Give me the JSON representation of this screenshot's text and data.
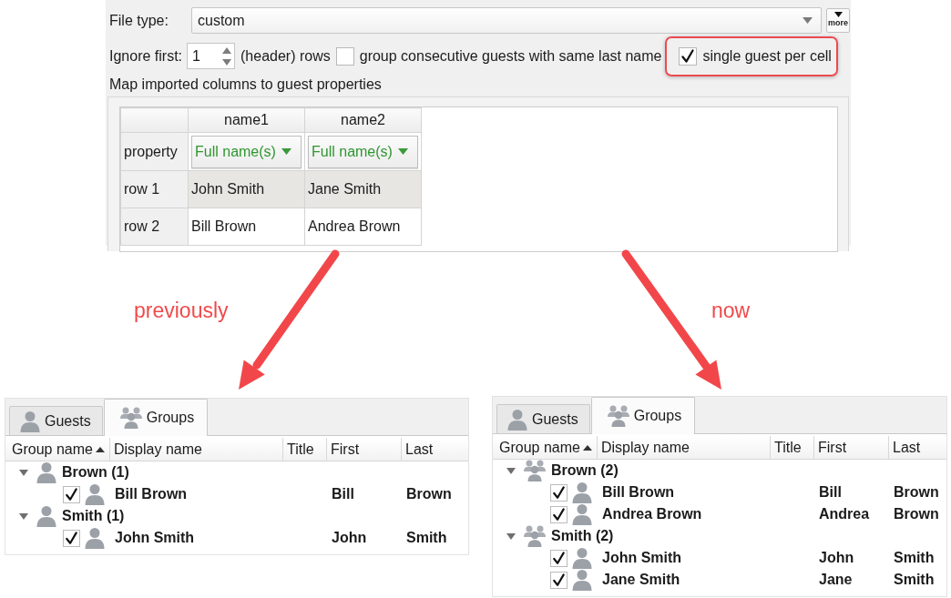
{
  "import_settings": {
    "file_type": {
      "label": "File type:",
      "value": "custom"
    },
    "more_button": {
      "label": "more"
    },
    "ignore_first": {
      "label": "Ignore first:",
      "value": "1",
      "suffix": "(header) rows"
    },
    "options": [
      {
        "label": "group consecutive guests with same last name",
        "checked": false,
        "highlighted": false
      },
      {
        "label": "single guest per cell",
        "checked": true,
        "highlighted": true
      }
    ],
    "mapping": {
      "title": "Map imported columns to guest properties",
      "columns": [
        "name1",
        "name2"
      ],
      "property_row": {
        "header": "property",
        "values": [
          "Full name(s)",
          "Full name(s)"
        ]
      },
      "rows": [
        {
          "header": "row 1",
          "cells": [
            "John Smith",
            "Jane Smith"
          ]
        },
        {
          "header": "row 2",
          "cells": [
            "Bill Brown",
            "Andrea Brown"
          ]
        }
      ]
    }
  },
  "comparisons": [
    {
      "caption": "previously",
      "panel": {
        "tabs": [
          {
            "label": "Guests",
            "kind": "person",
            "selected": false
          },
          {
            "label": "Groups",
            "kind": "people",
            "selected": true
          }
        ],
        "columns": [
          {
            "label": "Group name",
            "sorted": true
          },
          {
            "label": "Display name",
            "sorted": false
          },
          {
            "label": "Title",
            "sorted": false
          },
          {
            "label": "First",
            "sorted": false
          },
          {
            "label": "Last",
            "sorted": false
          }
        ],
        "groups": [
          {
            "name": "Brown (1)",
            "kind": "person",
            "expanded": true,
            "children": [
              {
                "display_name": "Bill Brown",
                "first": "Bill",
                "last": "Brown",
                "checked": true
              }
            ]
          },
          {
            "name": "Smith (1)",
            "kind": "person",
            "expanded": true,
            "children": [
              {
                "display_name": "John Smith",
                "first": "John",
                "last": "Smith",
                "checked": true
              }
            ]
          }
        ]
      }
    },
    {
      "caption": "now",
      "panel": {
        "tabs": [
          {
            "label": "Guests",
            "kind": "person",
            "selected": false
          },
          {
            "label": "Groups",
            "kind": "people",
            "selected": true
          }
        ],
        "columns": [
          {
            "label": "Group name",
            "sorted": true
          },
          {
            "label": "Display name",
            "sorted": false
          },
          {
            "label": "Title",
            "sorted": false
          },
          {
            "label": "First",
            "sorted": false
          },
          {
            "label": "Last",
            "sorted": false
          }
        ],
        "groups": [
          {
            "name": "Brown (2)",
            "kind": "people",
            "expanded": true,
            "children": [
              {
                "display_name": "Bill Brown",
                "first": "Bill",
                "last": "Brown",
                "checked": true
              },
              {
                "display_name": "Andrea Brown",
                "first": "Andrea",
                "last": "Brown",
                "checked": true
              }
            ]
          },
          {
            "name": "Smith (2)",
            "kind": "people",
            "expanded": true,
            "children": [
              {
                "display_name": "John Smith",
                "first": "John",
                "last": "Smith",
                "checked": true
              },
              {
                "display_name": "Jane Smith",
                "first": "Jane",
                "last": "Smith",
                "checked": true
              }
            ]
          }
        ]
      }
    }
  ]
}
